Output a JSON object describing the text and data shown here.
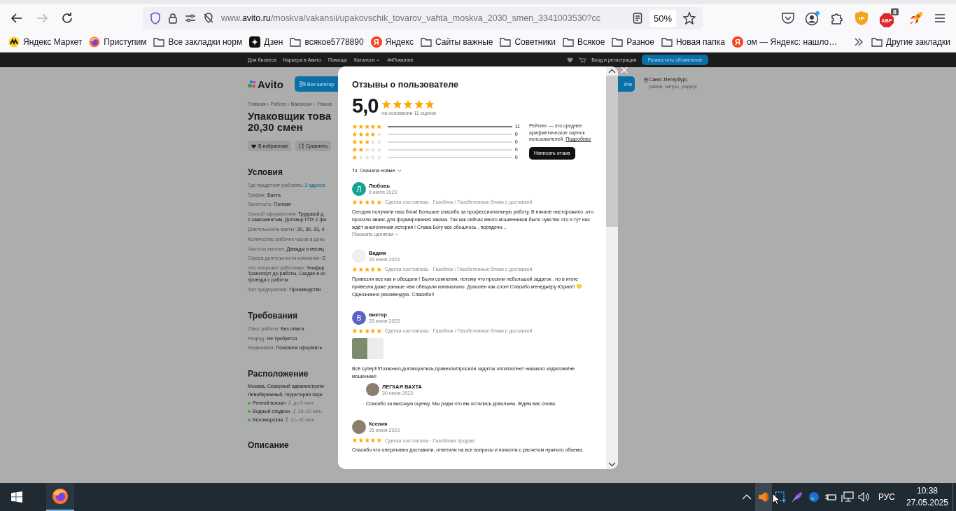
{
  "browser": {
    "nav": [
      {
        "kind": "back",
        "disabled": false
      },
      {
        "kind": "forward",
        "disabled": true
      },
      {
        "kind": "reload",
        "disabled": false
      }
    ],
    "url": {
      "prefix": "www.",
      "domain": "avito.ru",
      "path": "/moskva/vakansii/upakovschik_tovarov_vahta_moskva_2030_smen_3341003530?cc"
    },
    "zoom": "50%",
    "toolbar": [
      {
        "kind": "pocket"
      },
      {
        "kind": "account",
        "notification": true
      },
      {
        "kind": "extensions"
      },
      {
        "kind": "ip-shield",
        "label": "IP"
      },
      {
        "kind": "abp",
        "label": "ABP",
        "badge": "8"
      },
      {
        "kind": "rocket"
      },
      {
        "kind": "menu"
      }
    ],
    "bookmarks": [
      {
        "kind": "market",
        "label": "Яндекс Маркет"
      },
      {
        "kind": "firefox",
        "label": "Приступим"
      },
      {
        "kind": "folder",
        "label": "Все закладки норм"
      },
      {
        "kind": "dzen",
        "label": "Дзен"
      },
      {
        "kind": "folder",
        "label": "всякое5778890"
      },
      {
        "kind": "letter",
        "letter": "Я",
        "label": "Яндекс"
      },
      {
        "kind": "folder",
        "label": "Сайты важные"
      },
      {
        "kind": "folder",
        "label": "Советники"
      },
      {
        "kind": "folder",
        "label": "Всякое"
      },
      {
        "kind": "folder",
        "label": "Разное"
      },
      {
        "kind": "folder",
        "label": "Новая папка"
      },
      {
        "kind": "letter",
        "letter": "Я",
        "label": "ом — Яндекс: нашло…"
      }
    ],
    "other_bookmarks": {
      "kind": "folder",
      "label": "Другие закладки"
    }
  },
  "site": {
    "topnav": {
      "links": [
        {
          "label": "Для бизнеса",
          "dropdown": false
        },
        {
          "label": "Карьера в Авито",
          "dropdown": false
        },
        {
          "label": "Помощь",
          "dropdown": false
        },
        {
          "label": "Каталоги",
          "dropdown": true
        },
        {
          "label": "#яПомогаю",
          "dropdown": false
        }
      ],
      "login": "Вход и регистрация",
      "post_button": "Разместить объявление"
    },
    "logo": "Avito",
    "categories_button": "Все категор",
    "search_button": "йти",
    "location": {
      "city": "Санкт-Петербург,",
      "hint": "район, метро, радиус"
    },
    "breadcrumbs": [
      "Главная",
      "Работа",
      "Вакансии",
      "Упаков"
    ],
    "title_lines": [
      "Упаковщик това",
      "20,30 смен"
    ],
    "actions": [
      {
        "kind": "favorite",
        "label": "В избранном"
      },
      {
        "kind": "compare",
        "label": "Сравнить"
      }
    ],
    "sections": [
      {
        "kind": "rows",
        "title": "Условия",
        "rows": [
          {
            "label": "Где предстоит работать:",
            "value": "3 адреса",
            "link": true
          },
          {
            "label": "График:",
            "value": "Вахта",
            "link": false
          },
          {
            "label": "Занятость:",
            "value": "Полная",
            "link": false
          },
          {
            "label": "Способ оформления:",
            "value": "Трудовой д",
            "link": false,
            "more": [
              "с самозанятым, Договор ГПХ с фи"
            ]
          },
          {
            "label": "Длительность вахты:",
            "value": "20, 30, 33, 4",
            "link": false
          },
          {
            "label": "Количество рабочих часов в день",
            "link": false
          },
          {
            "label": "Частота выплат:",
            "value": "Дважды в месяц",
            "link": false
          },
          {
            "label": "Сфера деятельности компании:",
            "value": "С",
            "link": false
          },
          {
            "label": "Что получают работники:",
            "value": "Унифор",
            "link": false,
            "more": [
              "Транспорт до работы, Скидки в ко",
              "проезда с работы"
            ]
          },
          {
            "label": "Тип предприятия:",
            "value": "Производство",
            "link": false
          }
        ]
      },
      {
        "kind": "rows",
        "title": "Требования",
        "rows": [
          {
            "label": "Опыт работы:",
            "value": "Без опыта",
            "link": false
          },
          {
            "label": "Разряд:",
            "value": "Не требуется",
            "link": false
          },
          {
            "label": "Медкнижка:",
            "value": "Поможем оформить",
            "link": false
          }
        ]
      },
      {
        "kind": "location",
        "title": "Расположение",
        "address": [
          "Москва, Северный администрати",
          "Левобережный, территория парк"
        ],
        "metro": [
          {
            "name": "Речной вокзал",
            "time": "до 5 мин."
          },
          {
            "name": "Водный стадион",
            "time": "16–20 мин."
          },
          {
            "name": "Беломорская",
            "time": "21–30 мин."
          }
        ]
      },
      {
        "kind": "heading",
        "title": "Описание"
      }
    ]
  },
  "reviews_modal": {
    "title": "Отзывы о пользователе",
    "score": "5,0",
    "stars": 5,
    "based_on": "на основании 11 оценок",
    "histogram": [
      {
        "stars": 5,
        "level": 1,
        "count": "11"
      },
      {
        "stars": 4,
        "level": 0,
        "count": "0"
      },
      {
        "stars": 3,
        "level": 0,
        "count": "0"
      },
      {
        "stars": 2,
        "level": 0,
        "count": "0"
      },
      {
        "stars": 1,
        "level": 0,
        "count": "0"
      }
    ],
    "info": "Рейтинг — это среднее арифметическое оценок пользователей.",
    "info_link": "Подробнее",
    "write_button": "Написать отзыв",
    "sort": "Сначала новые",
    "reviews": [
      {
        "author": "Любовь",
        "avatar": {
          "kind": "letter",
          "letter": "Л",
          "color": "#1aa394"
        },
        "date": "6 июля 2023",
        "stars": 5,
        "meta": "Сделка состоялась · Газоблок / Газобетонные блоки с доставкой",
        "text": "Сегодня получили наш блок! Большое спасибо за профессиональную работу. В начале насторожило ,что просили аванс для формирования заказа. Так как сейчас много мошенников было чувство что и тут нас ждёт аналогичная история ! Слава Богу все обошлось , порядочн…",
        "expand": "Показать целиком"
      },
      {
        "author": "Вадим",
        "avatar": {
          "kind": "empty"
        },
        "date": "29 июня 2023",
        "stars": 5,
        "meta": "Сделка состоялась · Газоблок / Газобетонные блоки с доставкой",
        "text": "Привезли все как и обещали ! Были сомнения, потому что просили небольшой задаток , но в итоге привезли даже раньше чем обещали изначально. Доволен как слон! Спасибо менеджеру Юрию!! 💛 Однозначно рекомендую. Спасибо!!"
      },
      {
        "author": "виктор",
        "avatar": {
          "kind": "letter",
          "letter": "В",
          "color": "#5b64c4"
        },
        "date": "28 июня 2023",
        "stars": 5,
        "meta": "Сделка состоялась · Газоблок / Газобетонные блоки с доставкой",
        "photos": [
          {
            "kind": "photo"
          },
          {
            "kind": "empty"
          }
        ],
        "text": "Всё супер!!!Позвонил,договорились,привезли!просили задаток оплатил!нет никакого кидалова!не мошеники!",
        "reply": {
          "author": "ЛЕГКАЯ ВАХТА",
          "avatar": {
            "kind": "photo"
          },
          "date": "30 июня 2023",
          "text": "Спасибо за высокую оценку. Мы рады что вы остались довольны. Ждем вас снова."
        }
      },
      {
        "author": "Ксения",
        "avatar": {
          "kind": "photo"
        },
        "date": "26 июня 2023",
        "stars": 5,
        "meta": "Сделка состоялась · Газоблоки продаю",
        "text": "Спасибо что оперативно доставили, ответили на все вопросы и помогли с расчетом нужного обьема."
      }
    ]
  },
  "taskbar": {
    "apps": [
      {
        "kind": "firefox",
        "active": true
      }
    ],
    "tray": [
      {
        "kind": "chevron",
        "hovered": false
      },
      {
        "kind": "speaker-app",
        "hovered": true
      },
      {
        "kind": "snip",
        "hovered": false
      },
      {
        "kind": "feather",
        "hovered": false
      },
      {
        "kind": "globe",
        "hovered": false
      },
      {
        "kind": "power",
        "hovered": false
      },
      {
        "kind": "network",
        "hovered": false
      },
      {
        "kind": "volume",
        "hovered": false
      }
    ],
    "lang": "РУС",
    "time": "10:38",
    "date": "27.05.2025"
  }
}
